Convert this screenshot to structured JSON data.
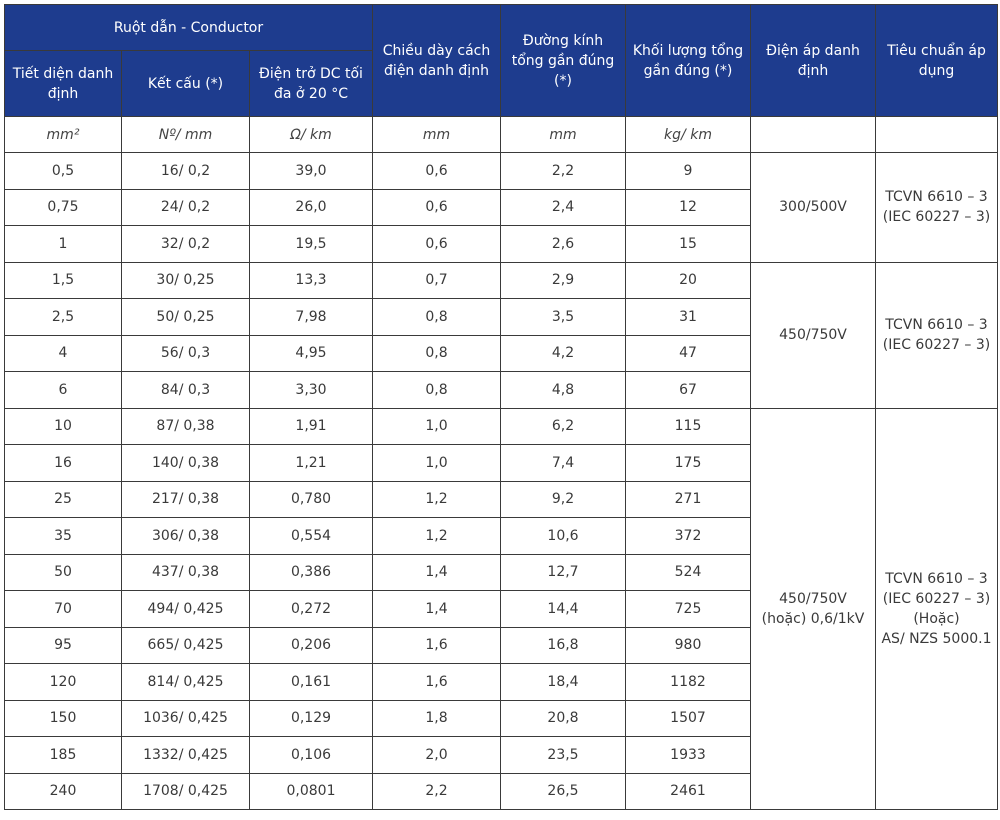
{
  "header": {
    "group": "Ruột dẫn - Conductor",
    "cross_section": "Tiết diện danh định",
    "structure": "Kết cấu (*)",
    "resistance": "Điện trở DC tối đa ở 20 °C",
    "insulation": "Chiều dày cách điện danh định",
    "diameter": "Đường kính tổng gần đúng (*)",
    "weight": "Khối lượng tổng gần đúng (*)",
    "voltage": "Điện áp danh định",
    "standard": "Tiêu chuẩn áp dụng"
  },
  "units": {
    "cross_section": "mm²",
    "structure": "Nº/ mm",
    "resistance": "Ω/ km",
    "insulation": "mm",
    "diameter": "mm",
    "weight": "kg/ km"
  },
  "rows": [
    [
      "0,5",
      "16/ 0,2",
      "39,0",
      "0,6",
      "2,2",
      "9"
    ],
    [
      "0,75",
      "24/ 0,2",
      "26,0",
      "0,6",
      "2,4",
      "12"
    ],
    [
      "1",
      "32/ 0,2",
      "19,5",
      "0,6",
      "2,6",
      "15"
    ],
    [
      "1,5",
      "30/ 0,25",
      "13,3",
      "0,7",
      "2,9",
      "20"
    ],
    [
      "2,5",
      "50/ 0,25",
      "7,98",
      "0,8",
      "3,5",
      "31"
    ],
    [
      "4",
      "56/ 0,3",
      "4,95",
      "0,8",
      "4,2",
      "47"
    ],
    [
      "6",
      "84/ 0,3",
      "3,30",
      "0,8",
      "4,8",
      "67"
    ],
    [
      "10",
      "87/ 0,38",
      "1,91",
      "1,0",
      "6,2",
      "115"
    ],
    [
      "16",
      "140/ 0,38",
      "1,21",
      "1,0",
      "7,4",
      "175"
    ],
    [
      "25",
      "217/ 0,38",
      "0,780",
      "1,2",
      "9,2",
      "271"
    ],
    [
      "35",
      "306/ 0,38",
      "0,554",
      "1,2",
      "10,6",
      "372"
    ],
    [
      "50",
      "437/ 0,38",
      "0,386",
      "1,4",
      "12,7",
      "524"
    ],
    [
      "70",
      "494/ 0,425",
      "0,272",
      "1,4",
      "14,4",
      "725"
    ],
    [
      "95",
      "665/ 0,425",
      "0,206",
      "1,6",
      "16,8",
      "980"
    ],
    [
      "120",
      "814/ 0,425",
      "0,161",
      "1,6",
      "18,4",
      "1182"
    ],
    [
      "150",
      "1036/ 0,425",
      "0,129",
      "1,8",
      "20,8",
      "1507"
    ],
    [
      "185",
      "1332/ 0,425",
      "0,106",
      "2,0",
      "23,5",
      "1933"
    ],
    [
      "240",
      "1708/ 0,425",
      "0,0801",
      "2,2",
      "26,5",
      "2461"
    ]
  ],
  "groups": [
    {
      "voltage": [
        "300/500V"
      ],
      "standard": [
        "TCVN 6610 – 3",
        "(IEC 60227 – 3)"
      ]
    },
    {
      "voltage": [
        "450/750V"
      ],
      "standard": [
        "TCVN 6610 – 3",
        "(IEC 60227 – 3)"
      ]
    },
    {
      "voltage": [
        "450/750V",
        "(hoặc) 0,6/1kV"
      ],
      "standard": [
        "TCVN 6610 – 3",
        "(IEC 60227 – 3)",
        "(Hoặc)",
        "AS/ NZS 5000.1"
      ]
    }
  ],
  "colors": {
    "header_bg": "#1e3c8e",
    "header_text": "#ffffff",
    "border": "#3a3a3a"
  }
}
